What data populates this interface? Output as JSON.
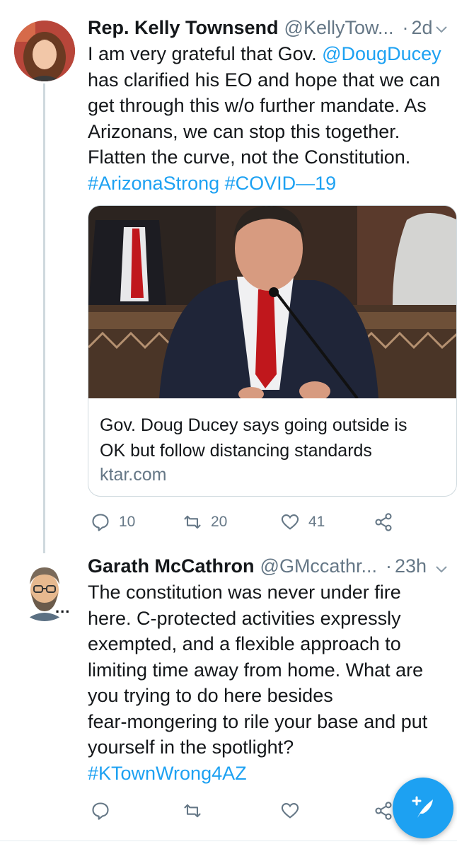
{
  "tweets": [
    {
      "name": "Rep. Kelly Townsend",
      "handle": "@KellyTow...",
      "separator": "·",
      "time": "2d",
      "text_lines": [
        "I am very grateful that Gov. ",
        "has clarified his EO and hope that we can",
        "get through this w/o further mandate.  As",
        "Arizonans, we can stop this together.",
        "Flatten the curve, not the Constitution."
      ],
      "mention": "@DougDucey",
      "hashtags": "#ArizonaStrong #COVID—19",
      "card": {
        "title_lines": [
          "Gov. Doug Ducey says going outside is",
          "OK but follow distancing standards"
        ],
        "domain": "ktar.com"
      },
      "actions": {
        "replies": "10",
        "retweets": "20",
        "likes": "41"
      }
    },
    {
      "name": "Garath McCathron",
      "handle": "@GMccathr...",
      "separator": "·",
      "time": "23h",
      "text_lines": [
        "The constitution was never under fire",
        "here. C-protected activities expressly",
        "exempted, and a flexible approach to",
        "limiting time away from home. What are",
        "you trying to do here besides",
        "fear-mongering to rile your base and put",
        "yourself in the spotlight?"
      ],
      "hashtags": "#KTownWrong4AZ",
      "more": "..."
    }
  ],
  "colors": {
    "link": "#1da1f2",
    "muted": "#657786",
    "text": "#14171a",
    "fab": "#1da1f2"
  },
  "icons": [
    "reply-icon",
    "retweet-icon",
    "like-icon",
    "share-icon",
    "chevron-down-icon",
    "compose-tweet-icon"
  ]
}
